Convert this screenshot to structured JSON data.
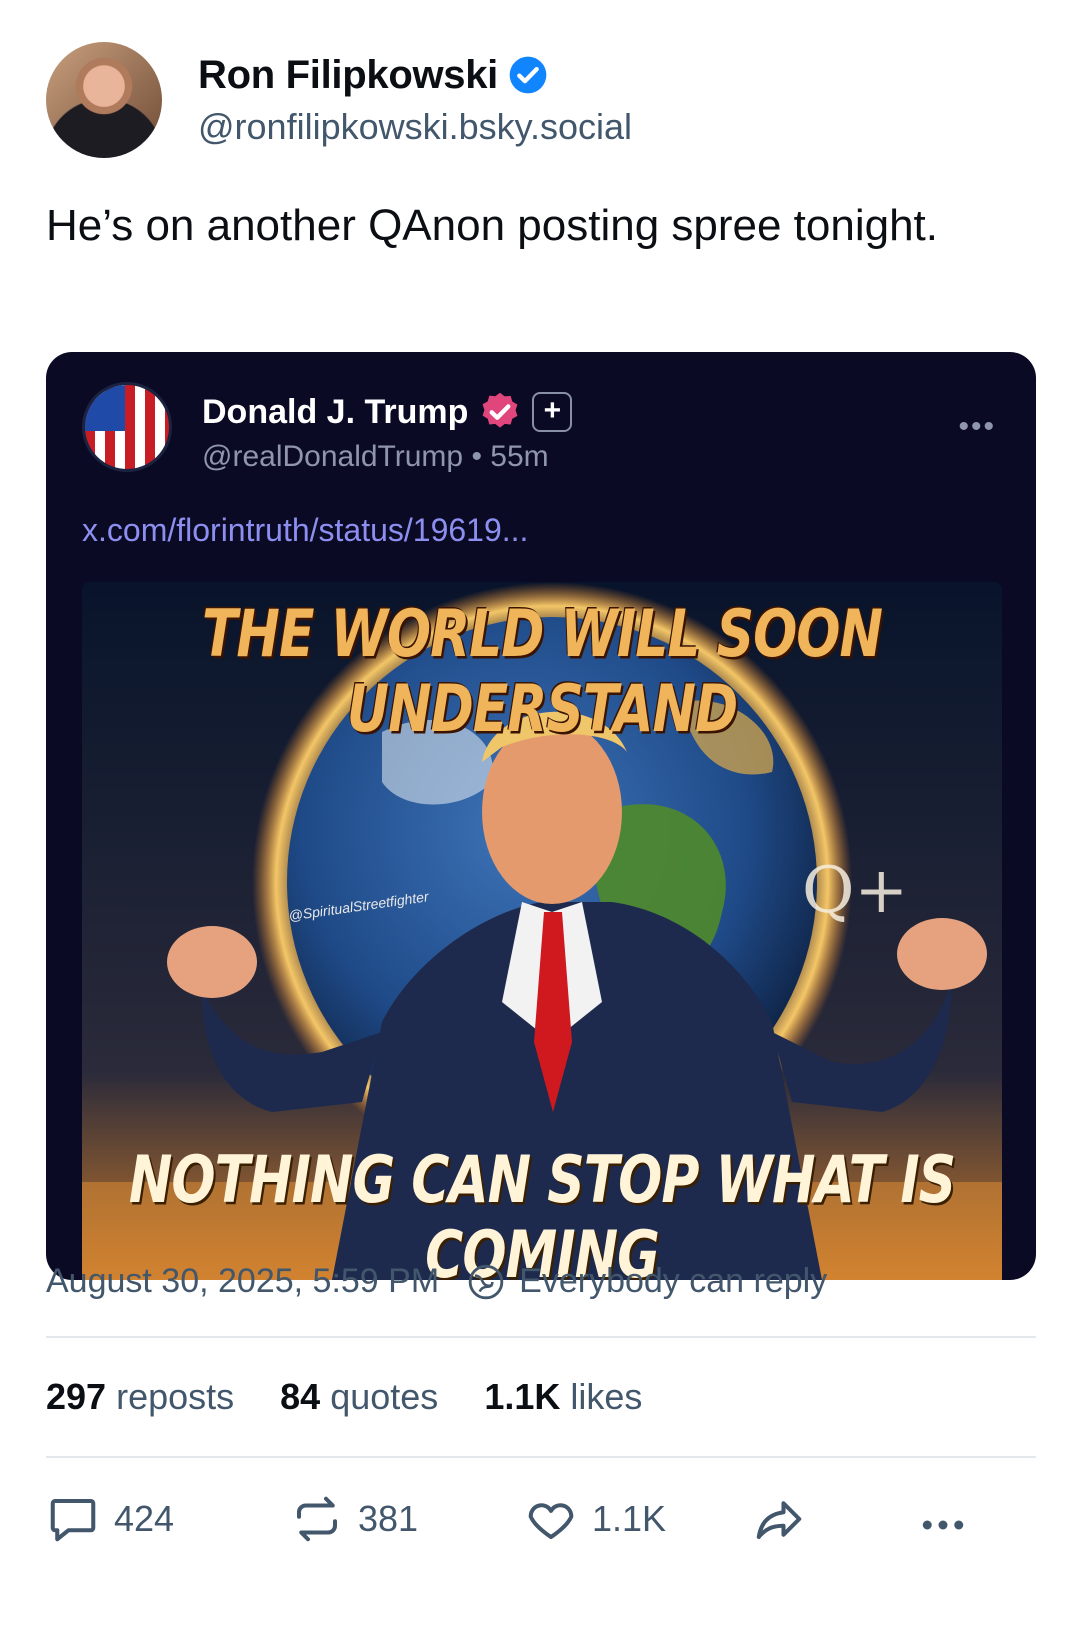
{
  "author": {
    "display_name": "Ron Filipkowski",
    "handle": "@ronfilipkowski.bsky.social",
    "verified": true
  },
  "post": {
    "text": "He’s on another QAnon posting spree tonight."
  },
  "embed": {
    "display_name": "Donald J. Trump",
    "handle_time": "@realDonaldTrump • 55m",
    "more_label": "•••",
    "plus_label": "+",
    "link": "x.com/florintruth/status/19619...",
    "image": {
      "headline_top": "THE WORLD WILL SOON UNDERSTAND",
      "headline_bottom": "NOTHING CAN STOP WHAT IS COMING",
      "watermark": "@SpiritualStreetfighter"
    }
  },
  "meta": {
    "timestamp": "August 30, 2025, 5:59 PM",
    "reply_setting": "Everybody can reply"
  },
  "counts": {
    "reposts_value": "297",
    "reposts_label": "reposts",
    "quotes_value": "84",
    "quotes_label": "quotes",
    "likes_value": "1.1K",
    "likes_label": "likes"
  },
  "actions": {
    "reply_count": "424",
    "repost_count": "381",
    "like_count": "1.1K"
  },
  "colors": {
    "accent_blue": "#1185fe",
    "verified_pink": "#e0457b",
    "embed_bg": "#0b0a24",
    "link_color": "#8c8ff0"
  }
}
